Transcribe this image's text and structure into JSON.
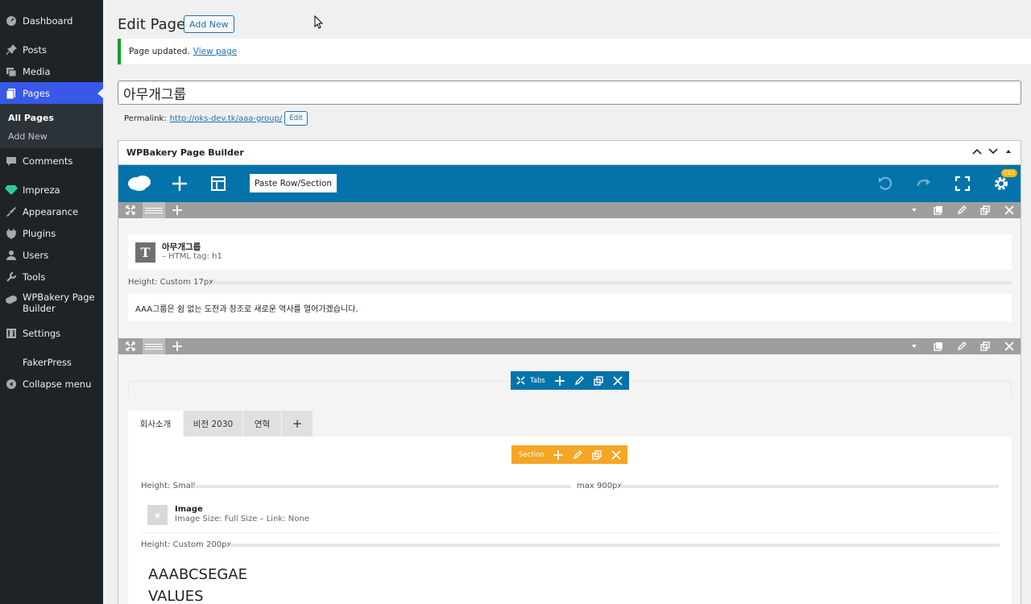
{
  "sidebar": {
    "items": [
      {
        "label": "Dashboard",
        "icon": "dashboard-icon"
      },
      {
        "label": "Posts",
        "icon": "pin-icon"
      },
      {
        "label": "Media",
        "icon": "media-icon"
      },
      {
        "label": "Pages",
        "icon": "pages-icon"
      },
      {
        "label": "Comments",
        "icon": "comment-icon"
      },
      {
        "label": "Impreza",
        "icon": "diamond-icon"
      },
      {
        "label": "Appearance",
        "icon": "brush-icon"
      },
      {
        "label": "Plugins",
        "icon": "plugin-icon"
      },
      {
        "label": "Users",
        "icon": "user-icon"
      },
      {
        "label": "Tools",
        "icon": "wrench-icon"
      },
      {
        "label": "WPBakery Page Builder",
        "icon": "cloud-icon"
      },
      {
        "label": "Settings",
        "icon": "settings-icon"
      },
      {
        "label": "FakerPress",
        "icon": ""
      },
      {
        "label": "Collapse menu",
        "icon": "collapse-icon"
      }
    ],
    "submenu": [
      "All Pages",
      "Add New"
    ]
  },
  "header": {
    "title": "Edit Page",
    "add_new": "Add New"
  },
  "notice": {
    "text": "Page updated.",
    "link": "View page"
  },
  "post_title": "아무개그룹",
  "permalink": {
    "label": "Permalink:",
    "url": "http://oks-dev.tk/aaa-group/",
    "edit": "Edit"
  },
  "builder": {
    "box_title": "WPBakery Page Builder",
    "paste_label": "Paste Row/Section",
    "css_badge": "CSS",
    "heading_title": "아무개그룹",
    "heading_sub": "– HTML tag: h1",
    "spacer1_label": "Height: Custom  17px",
    "text_block": "AAA그룹은 쉼 없는 도전과 창조로 새로운 역사를 열어가겠습니다.",
    "tabs_label": "Tabs",
    "tabs": [
      "회사소개",
      "비전 2030",
      "연혁"
    ],
    "tab_add": "+",
    "section_label": "Section",
    "spacer2_label": "Height: Small",
    "spacer2_max": "max 900px",
    "image_title": "Image",
    "image_sub": "Image Size: Full Size  – Link: None",
    "spacer3_label": "Height: Custom  200px",
    "big_text_1": "AAABCSEGAE",
    "big_text_2": "VALUES"
  },
  "colors": {
    "sidebar_bg": "#1d2327",
    "active_menu": "#3858e9",
    "toolbar": "#0473aa",
    "row_bar": "#9e9e9e",
    "section_ctl": "#f5a623",
    "notice_border": "#00a32a"
  }
}
